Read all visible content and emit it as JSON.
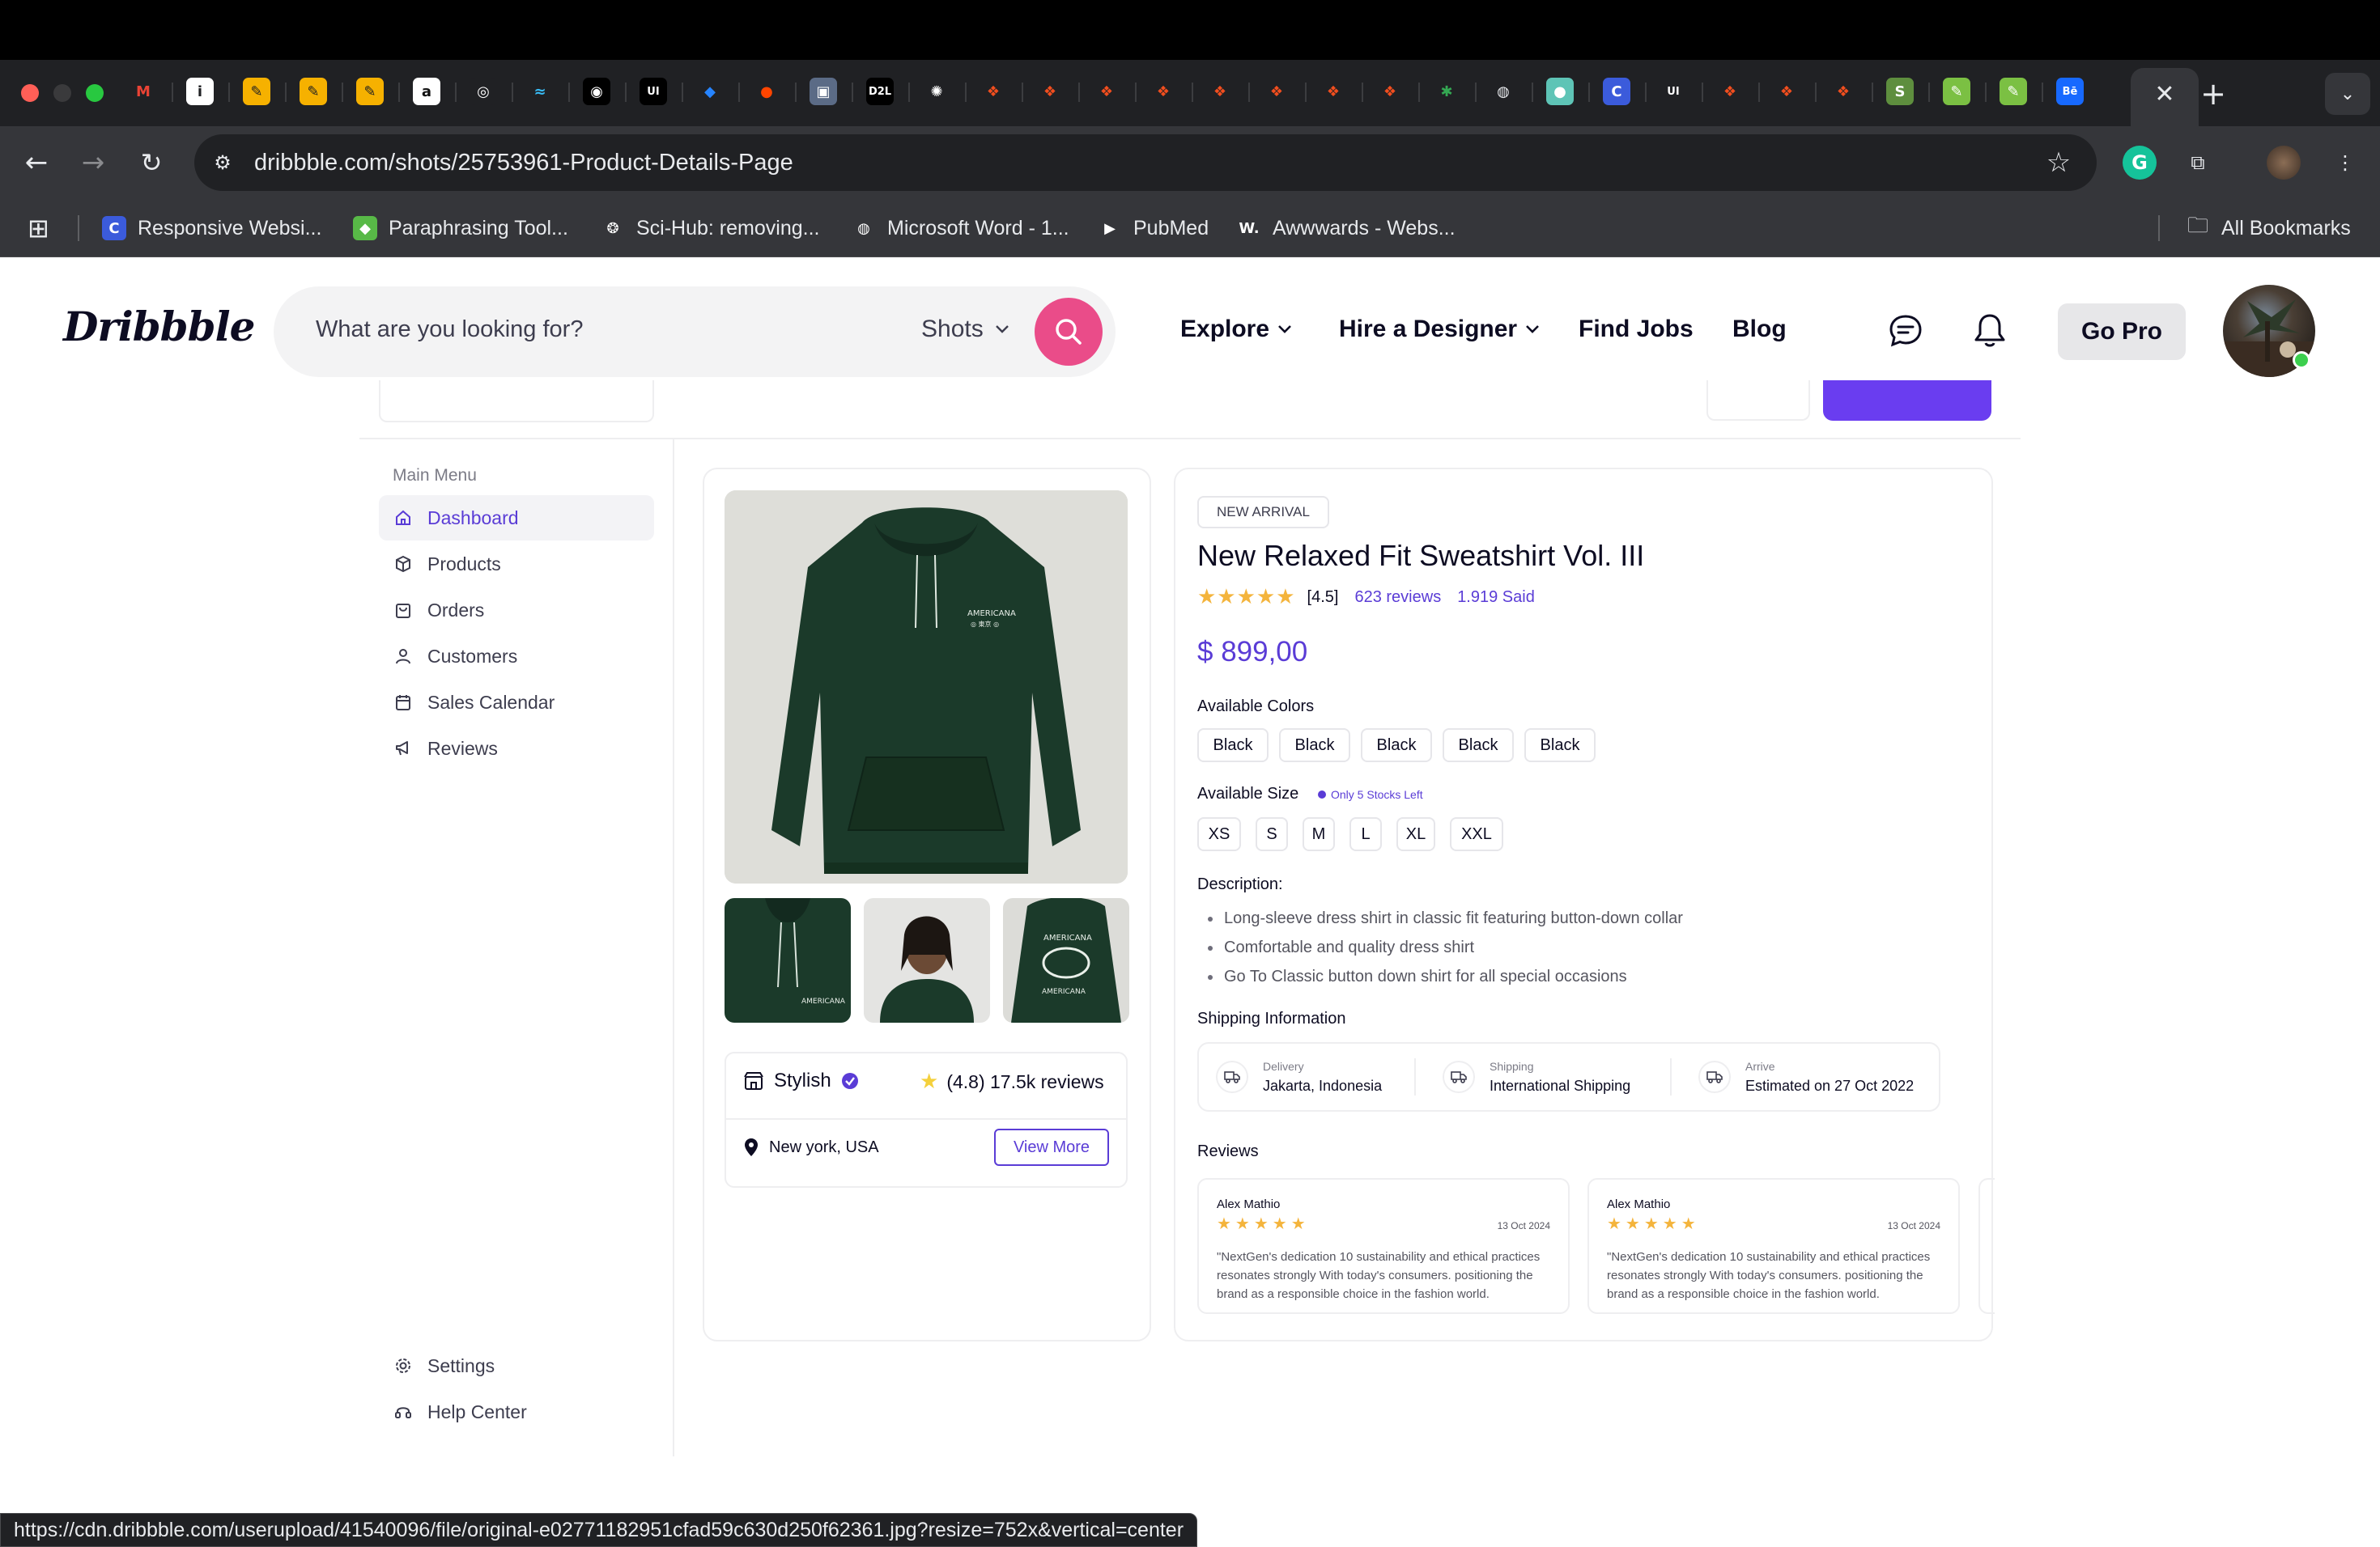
{
  "browser": {
    "url": "dribbble.com/shots/25753961-Product-Details-Page",
    "active_tab_close": "✕",
    "new_tab": "+",
    "tabs_icons": [
      {
        "name": "gmail-tab-icon",
        "glyph": "M",
        "bg": "transparent",
        "fg": "#ea4335"
      },
      {
        "name": "info-tab-icon",
        "glyph": "i",
        "bg": "#ffffff",
        "fg": "#202124"
      },
      {
        "name": "tab-icon-3",
        "glyph": "✎",
        "bg": "#f6b100",
        "fg": "#222"
      },
      {
        "name": "tab-icon-4",
        "glyph": "✎",
        "bg": "#f6b100",
        "fg": "#222"
      },
      {
        "name": "tab-icon-5",
        "glyph": "✎",
        "bg": "#f6b100",
        "fg": "#222"
      },
      {
        "name": "amazon-tab-icon",
        "glyph": "a",
        "bg": "#ffffff",
        "fg": "#111"
      },
      {
        "name": "chatgpt-tab-icon",
        "glyph": "◎",
        "bg": "#202124",
        "fg": "#fff"
      },
      {
        "name": "tailwind-tab-icon",
        "glyph": "≈",
        "bg": "transparent",
        "fg": "#38bdf8"
      },
      {
        "name": "tab-icon-9",
        "glyph": "◉",
        "bg": "#000",
        "fg": "#fff"
      },
      {
        "name": "ui-tab-icon",
        "glyph": "UI",
        "bg": "#000",
        "fg": "#fff"
      },
      {
        "name": "jira-tab-icon",
        "glyph": "◆",
        "bg": "transparent",
        "fg": "#2684ff"
      },
      {
        "name": "reddit-tab-icon",
        "glyph": "●",
        "bg": "transparent",
        "fg": "#ff4500"
      },
      {
        "name": "tab-icon-13",
        "glyph": "▣",
        "bg": "#5b6b86",
        "fg": "#fff"
      },
      {
        "name": "d2l-tab-icon",
        "glyph": "D2L",
        "bg": "#000",
        "fg": "#fff"
      },
      {
        "name": "openai-tab-icon",
        "glyph": "✺",
        "bg": "transparent",
        "fg": "#fff"
      },
      {
        "name": "figma-tab-icon-1",
        "glyph": "❖",
        "bg": "transparent",
        "fg": "#f24e1e"
      },
      {
        "name": "figma-tab-icon-2",
        "glyph": "❖",
        "bg": "transparent",
        "fg": "#f24e1e"
      },
      {
        "name": "figma-tab-icon-3",
        "glyph": "❖",
        "bg": "transparent",
        "fg": "#f24e1e"
      },
      {
        "name": "figma-tab-icon-4",
        "glyph": "❖",
        "bg": "transparent",
        "fg": "#f24e1e"
      },
      {
        "name": "figma-tab-icon-5",
        "glyph": "❖",
        "bg": "transparent",
        "fg": "#f24e1e"
      },
      {
        "name": "figma-tab-icon-6",
        "glyph": "❖",
        "bg": "transparent",
        "fg": "#f24e1e"
      },
      {
        "name": "figma-tab-icon-7",
        "glyph": "❖",
        "bg": "transparent",
        "fg": "#f24e1e"
      },
      {
        "name": "figma-tab-icon-8",
        "glyph": "❖",
        "bg": "transparent",
        "fg": "#f24e1e"
      },
      {
        "name": "tab-icon-24",
        "glyph": "✱",
        "bg": "transparent",
        "fg": "#34a853"
      },
      {
        "name": "chrome-tab-icon",
        "glyph": "◍",
        "bg": "transparent",
        "fg": "#e8eaed"
      },
      {
        "name": "tab-icon-26",
        "glyph": "●",
        "bg": "#5ec4b6",
        "fg": "#fff"
      },
      {
        "name": "tab-icon-27",
        "glyph": "C",
        "bg": "#3b5bdb",
        "fg": "#fff"
      },
      {
        "name": "ui-tab-icon-2",
        "glyph": "UI",
        "bg": "transparent",
        "fg": "#fff"
      },
      {
        "name": "figma-tab-icon-9",
        "glyph": "❖",
        "bg": "transparent",
        "fg": "#f24e1e"
      },
      {
        "name": "figma-tab-icon-10",
        "glyph": "❖",
        "bg": "transparent",
        "fg": "#f24e1e"
      },
      {
        "name": "figma-tab-icon-11",
        "glyph": "❖",
        "bg": "transparent",
        "fg": "#f24e1e"
      },
      {
        "name": "shopify-tab-icon",
        "glyph": "S",
        "bg": "#5e8e3e",
        "fg": "#fff"
      },
      {
        "name": "tab-icon-33",
        "glyph": "✎",
        "bg": "#7bc043",
        "fg": "#fff"
      },
      {
        "name": "tab-icon-34",
        "glyph": "✎",
        "bg": "#7bc043",
        "fg": "#fff"
      },
      {
        "name": "behance-tab-icon",
        "glyph": "Bē",
        "bg": "#1769ff",
        "fg": "#fff"
      }
    ],
    "bookmarks": [
      {
        "label": "Responsive Websi...",
        "glyph": "C",
        "bg": "#3b5bdb"
      },
      {
        "label": "Paraphrasing Tool...",
        "glyph": "◆",
        "bg": "#58b947"
      },
      {
        "label": "Sci-Hub: removing...",
        "glyph": "❂",
        "bg": "transparent"
      },
      {
        "label": "Microsoft Word - 1...",
        "glyph": "◍",
        "bg": "transparent"
      },
      {
        "label": "PubMed",
        "glyph": "▶",
        "bg": "transparent"
      },
      {
        "label": "Awwwards - Webs...",
        "glyph": "W.",
        "bg": "transparent"
      }
    ],
    "all_bookmarks": "All Bookmarks",
    "status_url": "https://cdn.dribbble.com/userupload/41540096/file/original-e02771182951cfad59c630d250f62361.jpg?resize=752x&vertical=center"
  },
  "dribbble": {
    "logo": "Dribbble",
    "search_placeholder": "What are you looking for?",
    "search_scope": "Shots",
    "nav": {
      "explore": "Explore",
      "hire": "Hire a Designer",
      "jobs": "Find Jobs",
      "blog": "Blog",
      "go_pro": "Go Pro"
    },
    "accent": "#ea4c89"
  },
  "shot": {
    "sidebar": {
      "title": "Main Menu",
      "items": [
        {
          "label": "Dashboard",
          "icon": "home-icon",
          "active": true
        },
        {
          "label": "Products",
          "icon": "box-icon",
          "active": false
        },
        {
          "label": "Orders",
          "icon": "bag-icon",
          "active": false
        },
        {
          "label": "Customers",
          "icon": "user-icon",
          "active": false
        },
        {
          "label": "Sales Calendar",
          "icon": "calendar-icon",
          "active": false
        },
        {
          "label": "Reviews",
          "icon": "megaphone-icon",
          "active": false
        }
      ],
      "bottom": [
        {
          "label": "Settings",
          "icon": "gear-icon"
        },
        {
          "label": "Help Center",
          "icon": "headset-icon"
        }
      ]
    },
    "store": {
      "name": "Stylish",
      "rating": "(4.8) 17.5k reviews",
      "location": "New york, USA",
      "view_more": "View More"
    },
    "product": {
      "badge": "NEW ARRIVAL",
      "title": "New Relaxed Fit Sweatshirt Vol. III",
      "rating": "[4.5]",
      "rating_value": 4.5,
      "reviews": "623 reviews",
      "sold": "1.919 Said",
      "price": "$ 899,00",
      "colors_label": "Available Colors",
      "colors": [
        "Black",
        "Black",
        "Black",
        "Black",
        "Black"
      ],
      "size_label": "Available Size",
      "stock_note": "Only 5 Stocks Left",
      "sizes": [
        "XS",
        "S",
        "M",
        "L",
        "XL",
        "XXL"
      ],
      "description_label": "Description:",
      "description": [
        "Long-sleeve dress shirt in classic fit featuring button-down collar",
        "Comfortable and quality dress shirt",
        "Go To Classic button down shirt for all special occasions"
      ],
      "shipping_label": "Shipping Information",
      "shipping": [
        {
          "small": "Delivery",
          "big": "Jakarta, Indonesia"
        },
        {
          "small": "Shipping",
          "big": "International Shipping"
        },
        {
          "small": "Arrive",
          "big": "Estimated on 27 Oct 2022"
        }
      ],
      "reviews_label": "Reviews",
      "review_cards": [
        {
          "name": "Alex Mathio",
          "stars": 5,
          "date": "13 Oct 2024",
          "text": "\"NextGen's dedication 10 sustainability and ethical practices resonates strongly   With today's consumers. positioning the brand as a responsible choice in the   fashion world."
        },
        {
          "name": "Alex Mathio",
          "stars": 5,
          "date": "13 Oct 2024",
          "text": "\"NextGen's dedication 10 sustainability and ethical practices resonates strongly   With today's consumers. positioning the brand as a responsible choice in the   fashion world."
        }
      ],
      "hoodie_color": "#1b3a2a"
    }
  }
}
